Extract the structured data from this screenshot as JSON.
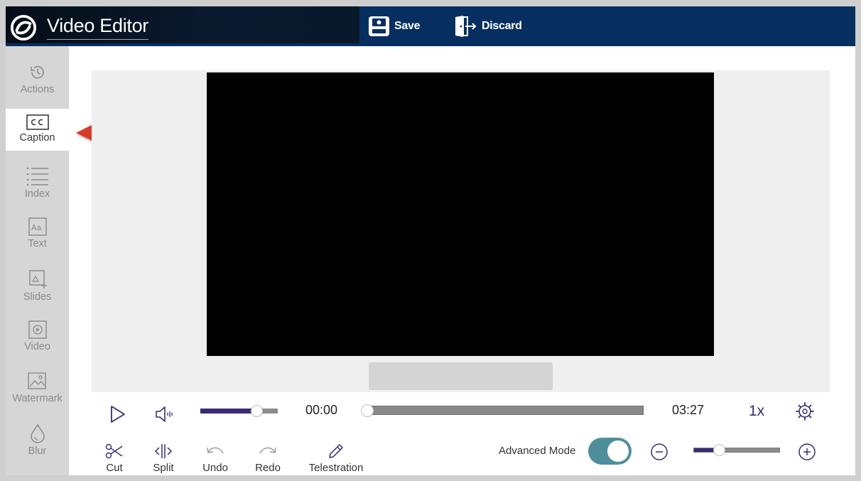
{
  "header": {
    "title": "Video Editor",
    "save_label": "Save",
    "discard_label": "Discard"
  },
  "sidebar": {
    "items": [
      {
        "label": "Actions",
        "icon": "history-icon",
        "active": false
      },
      {
        "label": "Caption",
        "icon": "closed-caption-icon",
        "active": true
      },
      {
        "label": "Index",
        "icon": "list-icon",
        "active": false
      },
      {
        "label": "Text",
        "icon": "text-aa-icon",
        "active": false
      },
      {
        "label": "Slides",
        "icon": "slide-add-icon",
        "active": false
      },
      {
        "label": "Video",
        "icon": "video-play-icon",
        "active": false
      },
      {
        "label": "Watermark",
        "icon": "image-icon",
        "active": false
      },
      {
        "label": "Blur",
        "icon": "droplet-icon",
        "active": false
      }
    ]
  },
  "player": {
    "current_time": "00:00",
    "total_time": "03:27",
    "speed": "1x",
    "volume_level": 0.73,
    "seek_position": 0.0
  },
  "tools": {
    "cut": "Cut",
    "split": "Split",
    "undo": "Undo",
    "redo": "Redo",
    "telestration": "Telestration"
  },
  "advanced_mode": {
    "label": "Advanced Mode",
    "enabled": true
  },
  "zoom": {
    "level": 0.3
  },
  "colors": {
    "header_bg": "#062f60",
    "accent": "#3b2a73",
    "toggle_on": "#4f8f9c",
    "annotation_arrow": "#d93a26"
  }
}
